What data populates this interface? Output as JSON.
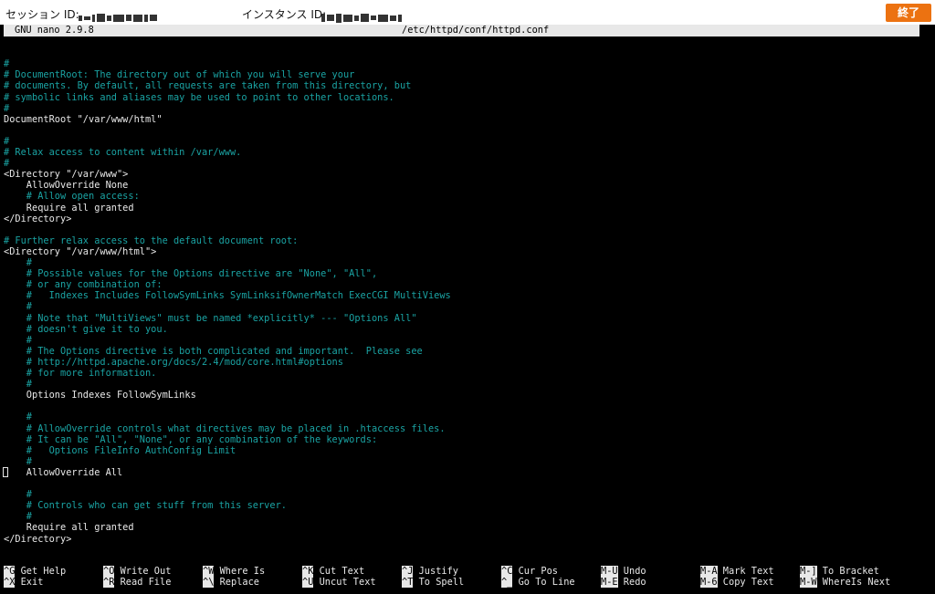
{
  "session": {
    "session_label": "セッション ID:",
    "instance_label": "インスタンス ID:",
    "end_button": "終了"
  },
  "nano": {
    "version": "GNU nano 2.9.8",
    "filename": "/etc/httpd/conf/httpd.conf"
  },
  "lines": [
    {
      "row": 3,
      "text": "#",
      "cls": "c"
    },
    {
      "row": 4,
      "text": "# DocumentRoot: The directory out of which you will serve your",
      "cls": "c"
    },
    {
      "row": 5,
      "text": "# documents. By default, all requests are taken from this directory, but",
      "cls": "c"
    },
    {
      "row": 6,
      "text": "# symbolic links and aliases may be used to point to other locations.",
      "cls": "c"
    },
    {
      "row": 7,
      "text": "#",
      "cls": "c"
    },
    {
      "row": 8,
      "text": "DocumentRoot \"/var/www/html\"",
      "cls": ""
    },
    {
      "row": 10,
      "text": "#",
      "cls": "c"
    },
    {
      "row": 11,
      "text": "# Relax access to content within /var/www.",
      "cls": "c"
    },
    {
      "row": 12,
      "text": "#",
      "cls": "c"
    },
    {
      "row": 13,
      "text": "<Directory \"/var/www\">",
      "cls": ""
    },
    {
      "row": 14,
      "text": "    AllowOverride None",
      "cls": ""
    },
    {
      "row": 15,
      "text": "    # Allow open access:",
      "cls": "c"
    },
    {
      "row": 16,
      "text": "    Require all granted",
      "cls": ""
    },
    {
      "row": 17,
      "text": "</Directory>",
      "cls": ""
    },
    {
      "row": 19,
      "text": "# Further relax access to the default document root:",
      "cls": "c"
    },
    {
      "row": 20,
      "text": "<Directory \"/var/www/html\">",
      "cls": ""
    },
    {
      "row": 21,
      "text": "    #",
      "cls": "c"
    },
    {
      "row": 22,
      "text": "    # Possible values for the Options directive are \"None\", \"All\",",
      "cls": "c"
    },
    {
      "row": 23,
      "text": "    # or any combination of:",
      "cls": "c"
    },
    {
      "row": 24,
      "text": "    #   Indexes Includes FollowSymLinks SymLinksifOwnerMatch ExecCGI MultiViews",
      "cls": "c"
    },
    {
      "row": 25,
      "text": "    #",
      "cls": "c"
    },
    {
      "row": 26,
      "text": "    # Note that \"MultiViews\" must be named *explicitly* --- \"Options All\"",
      "cls": "c"
    },
    {
      "row": 27,
      "text": "    # doesn't give it to you.",
      "cls": "c"
    },
    {
      "row": 28,
      "text": "    #",
      "cls": "c"
    },
    {
      "row": 29,
      "text": "    # The Options directive is both complicated and important.  Please see",
      "cls": "c"
    },
    {
      "row": 30,
      "text": "    # http://httpd.apache.org/docs/2.4/mod/core.html#options",
      "cls": "c"
    },
    {
      "row": 31,
      "text": "    # for more information.",
      "cls": "c"
    },
    {
      "row": 32,
      "text": "    #",
      "cls": "c"
    },
    {
      "row": 33,
      "text": "    Options Indexes FollowSymLinks",
      "cls": ""
    },
    {
      "row": 35,
      "text": "    #",
      "cls": "c"
    },
    {
      "row": 36,
      "text": "    # AllowOverride controls what directives may be placed in .htaccess files.",
      "cls": "c"
    },
    {
      "row": 37,
      "text": "    # It can be \"All\", \"None\", or any combination of the keywords:",
      "cls": "c"
    },
    {
      "row": 38,
      "text": "    #   Options FileInfo AuthConfig Limit",
      "cls": "c"
    },
    {
      "row": 39,
      "text": "    #",
      "cls": "c"
    },
    {
      "row": 40,
      "text": "    AllowOverride All",
      "cls": ""
    },
    {
      "row": 42,
      "text": "    #",
      "cls": "c"
    },
    {
      "row": 43,
      "text": "    # Controls who can get stuff from this server.",
      "cls": "c"
    },
    {
      "row": 44,
      "text": "    #",
      "cls": "c"
    },
    {
      "row": 45,
      "text": "    Require all granted",
      "cls": ""
    },
    {
      "row": 46,
      "text": "</Directory>",
      "cls": ""
    }
  ],
  "shortcuts": [
    {
      "key": "^G",
      "label": "Get Help",
      "col": 0,
      "row": 0
    },
    {
      "key": "^X",
      "label": "Exit",
      "col": 0,
      "row": 1
    },
    {
      "key": "^O",
      "label": "Write Out",
      "col": 1,
      "row": 0
    },
    {
      "key": "^R",
      "label": "Read File",
      "col": 1,
      "row": 1
    },
    {
      "key": "^W",
      "label": "Where Is",
      "col": 2,
      "row": 0
    },
    {
      "key": "^\\",
      "label": "Replace",
      "col": 2,
      "row": 1
    },
    {
      "key": "^K",
      "label": "Cut Text",
      "col": 3,
      "row": 0
    },
    {
      "key": "^U",
      "label": "Uncut Text",
      "col": 3,
      "row": 1
    },
    {
      "key": "^J",
      "label": "Justify",
      "col": 4,
      "row": 0
    },
    {
      "key": "^T",
      "label": "To Spell",
      "col": 4,
      "row": 1
    },
    {
      "key": "^C",
      "label": "Cur Pos",
      "col": 5,
      "row": 0
    },
    {
      "key": "^_",
      "label": "Go To Line",
      "col": 5,
      "row": 1
    },
    {
      "key": "M-U",
      "label": "Undo",
      "col": 6,
      "row": 0
    },
    {
      "key": "M-E",
      "label": "Redo",
      "col": 6,
      "row": 1
    },
    {
      "key": "M-A",
      "label": "Mark Text",
      "col": 7,
      "row": 0
    },
    {
      "key": "M-6",
      "label": "Copy Text",
      "col": 7,
      "row": 1
    },
    {
      "key": "M-]",
      "label": "To Bracket",
      "col": 8,
      "row": 0
    },
    {
      "key": "M-W",
      "label": "WhereIs Next",
      "col": 8,
      "row": 1
    }
  ],
  "colors": {
    "accent": "#ec7211",
    "terminal_bg": "#000000",
    "comment": "#1aa3a3",
    "text": "#e8e8e8"
  }
}
